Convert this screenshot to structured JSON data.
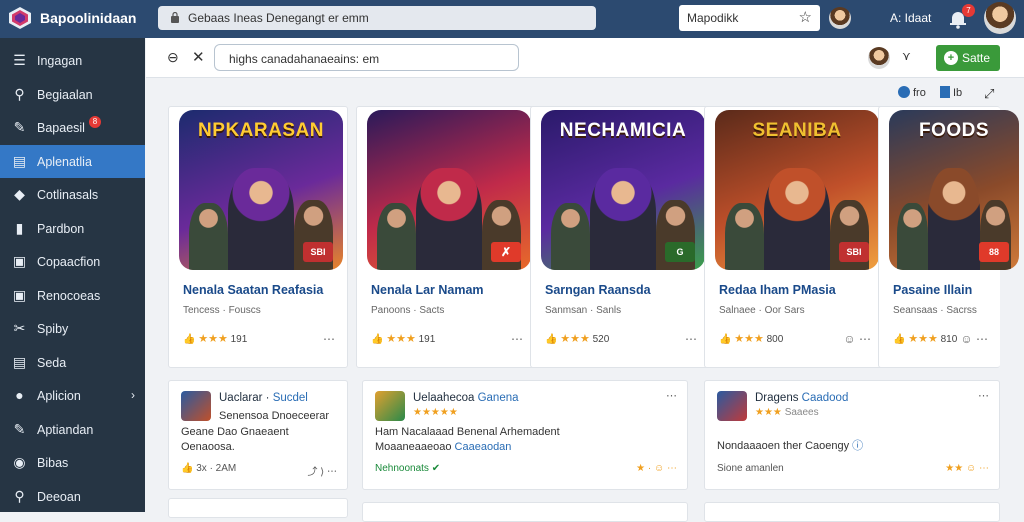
{
  "topbar": {
    "brand": "Bapoolinidaan",
    "url": "Gebaas Ineas Denegangt er emm",
    "search_text": "Mapodikk",
    "account_label": "A: Idaat",
    "notification_count": "7",
    "icons": [
      "app-logo-icon",
      "lock-icon",
      "star-icon",
      "bell-icon"
    ]
  },
  "sidebar": {
    "items": [
      {
        "label": "Ingagan",
        "icon": "menu-icon"
      },
      {
        "label": "Begiaalan",
        "icon": "person-icon"
      },
      {
        "label": "Bapaesil",
        "icon": "pen-icon",
        "badge": "8"
      },
      {
        "label": "Aplenatlia",
        "icon": "chart-icon",
        "active": true
      },
      {
        "label": "Cotlinasals",
        "icon": "tag-icon"
      },
      {
        "label": "Pardbon",
        "icon": "bag-icon"
      },
      {
        "label": "Copaacfion",
        "icon": "chart-box-icon"
      },
      {
        "label": "Renocoeas",
        "icon": "chart-box-icon"
      },
      {
        "label": "Spiby",
        "icon": "wrench-icon"
      },
      {
        "label": "Seda",
        "icon": "doc-icon"
      },
      {
        "label": "Aplicion",
        "icon": "circle-icon",
        "chevron": true
      },
      {
        "label": "Aptiandan",
        "icon": "pen-icon"
      },
      {
        "label": "Bibas",
        "icon": "palette-icon"
      },
      {
        "label": "Deeoan",
        "icon": "person-icon"
      }
    ]
  },
  "subbar": {
    "search_value": "highs canadahanaeains: em",
    "save_label": "Satte"
  },
  "view_controls": {
    "a": "fro",
    "b": "Ib"
  },
  "games": [
    {
      "art_title": "NPKARASAN",
      "tag": "SBI",
      "title": "Nenala Saatan Reafasia",
      "subtitle": "Tencess · Fouscs",
      "rating": "191",
      "colors": [
        "#1c2b6e",
        "#6a2a9a",
        "#e8842a"
      ],
      "title_color": "#ffcc33"
    },
    {
      "art_title": "",
      "tag": "",
      "title": "Nenala Lar Namam",
      "subtitle": "Panoons · Sacts",
      "rating": "191",
      "colors": [
        "#2a1a5a",
        "#c02a4a",
        "#e86a2a"
      ],
      "title_color": "#ffcc33"
    },
    {
      "art_title": "NECHAMICIA",
      "tag": "G",
      "title": "Sarngan Raansda",
      "subtitle": "Sanmsan · Sanls",
      "rating": "520",
      "colors": [
        "#2a1a6a",
        "#5a2aa0",
        "#3aa04a"
      ],
      "title_color": "#ffffff"
    },
    {
      "art_title": "SEANIBA",
      "tag": "SBI",
      "title": "Redaa Iham PMasia",
      "subtitle": "Salnaee · Oor Sars",
      "rating": "800",
      "colors": [
        "#5a2a1a",
        "#c0502a",
        "#f0a040"
      ],
      "title_color": "#f0c030"
    },
    {
      "art_title": "FOODS",
      "tag": "88",
      "title": "Pasaine Illain",
      "subtitle": "Seansaas · Sacrss",
      "rating": "810",
      "colors": [
        "#2a3a5a",
        "#8a4a2a",
        "#d07a3a"
      ],
      "title_color": "#ffffff"
    }
  ],
  "reviews": [
    {
      "title": "Uaclarar",
      "link": "Sucdel",
      "line1": "Senensoa Dnoeceerar",
      "line2": "Geane Dao Gnaeaent",
      "line3": "Oenaoosa.",
      "footer": "3x · 2AM",
      "stars": "★★★★★"
    },
    {
      "title": "Uelaahecoa",
      "link": "Ganena",
      "stars": "★★★★★",
      "line1": "Ham Nacalaaad Benenal Arhemadent",
      "line2": "Moaaneaaeoao",
      "link2": "Caaeaodan",
      "footer": "Nehnoonats",
      "rating": "★"
    },
    {
      "title": "Dragens",
      "link": "Caadood",
      "stars": "★★★",
      "stars_extra": "Saaees",
      "line1": "Nondaaaoen ther Caoengy",
      "footer": "Sione amanlen",
      "rating": "★★"
    }
  ]
}
